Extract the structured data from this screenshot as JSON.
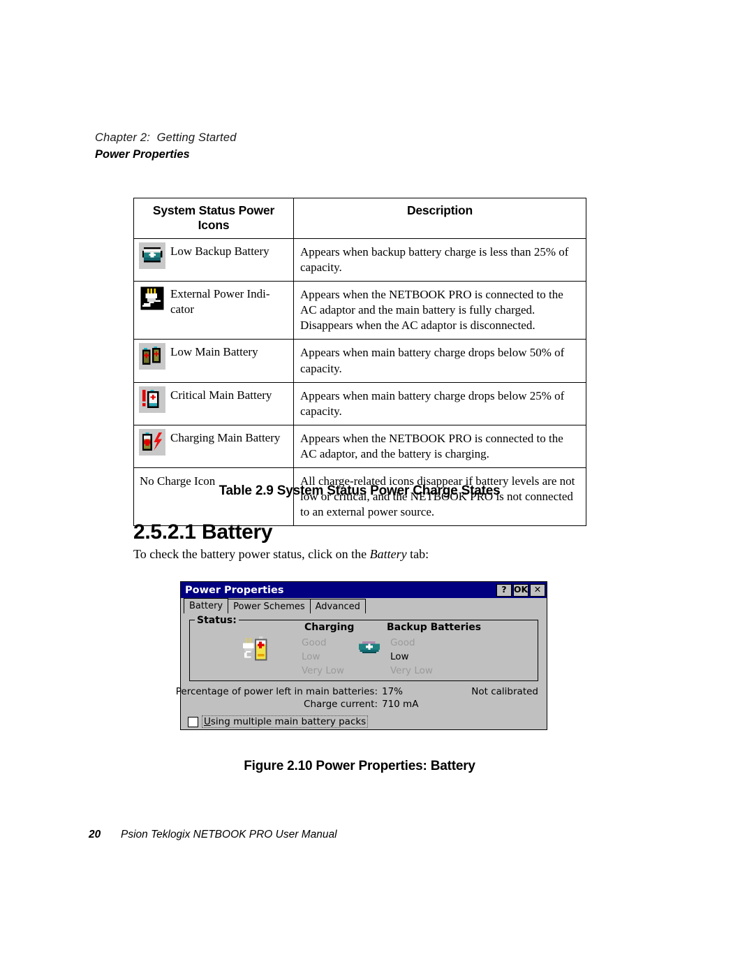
{
  "running_head": {
    "chapter": "Chapter 2:  Getting Started",
    "section": "Power Properties"
  },
  "table": {
    "headers": [
      "System Status Power Icons",
      "Description"
    ],
    "rows": [
      {
        "icon": "low-backup-battery-icon",
        "label": "Low Backup Battery",
        "description": "Appears when backup battery charge is less than 25% of capacity."
      },
      {
        "icon": "external-power-indicator-icon",
        "label": "External Power Indi-\ncator",
        "description": "Appears when the NETBOOK PRO is connected to the AC adaptor and the main battery is fully charged. Disappears when the AC adaptor is disconnected."
      },
      {
        "icon": "low-main-battery-icon",
        "label": "Low Main Battery",
        "description": "Appears when main battery charge drops below 50% of capacity."
      },
      {
        "icon": "critical-main-battery-icon",
        "label": "Critical Main Battery",
        "description": "Appears when main battery charge drops below 25% of capacity."
      },
      {
        "icon": "charging-main-battery-icon",
        "label": "Charging Main Battery",
        "description": "Appears when the NETBOOK PRO is connected to the AC adaptor, and the battery is charging."
      },
      {
        "icon": "none",
        "label": "No Charge Icon",
        "description": "All charge-related icons disappear if battery levels are not low or critical, and the NETBOOK PRO is not connected to an external power source."
      }
    ],
    "caption": "Table 2.9 System Status Power Charge States"
  },
  "section_heading": {
    "number": "2.5.2.1",
    "title": "Battery"
  },
  "body_paragraph": {
    "before": "To check the battery power status, click on the ",
    "emphasis": "Battery",
    "after": " tab:"
  },
  "dialog": {
    "title": "Power Properties",
    "titlebar_buttons": [
      {
        "name": "help-button",
        "label": "?"
      },
      {
        "name": "ok-button",
        "label": "OK"
      },
      {
        "name": "close-button",
        "label": "✕"
      }
    ],
    "tabs": [
      {
        "label": "Battery",
        "active": true
      },
      {
        "label": "Power Schemes",
        "active": false
      },
      {
        "label": "Advanced",
        "active": false
      }
    ],
    "groupbox_legend": "Status:",
    "columns": {
      "charging": "Charging",
      "backup": "Backup Batteries"
    },
    "charging_levels": [
      {
        "label": "Good",
        "active": false
      },
      {
        "label": "Low",
        "active": false
      },
      {
        "label": "Very Low",
        "active": false
      }
    ],
    "backup_levels": [
      {
        "label": "Good",
        "active": false
      },
      {
        "label": "Low",
        "active": true
      },
      {
        "label": "Very Low",
        "active": false
      }
    ],
    "info": [
      {
        "label": "Percentage of power left in main batteries:",
        "value": "17%",
        "extra": "Not calibrated"
      },
      {
        "label": "Charge current:",
        "value": "710 mA",
        "extra": ""
      }
    ],
    "checkbox": {
      "checked": false,
      "accel": "U",
      "label_rest": "sing multiple main battery packs"
    },
    "colors": {
      "titlebar": "#000080",
      "face": "#c0c0c0",
      "disabled_text": "#9a9a9a"
    }
  },
  "figure_caption": "Figure 2.10 Power Properties: Battery",
  "footer": {
    "page_number": "20",
    "manual_title": "Psion Teklogix NETBOOK PRO User Manual"
  }
}
